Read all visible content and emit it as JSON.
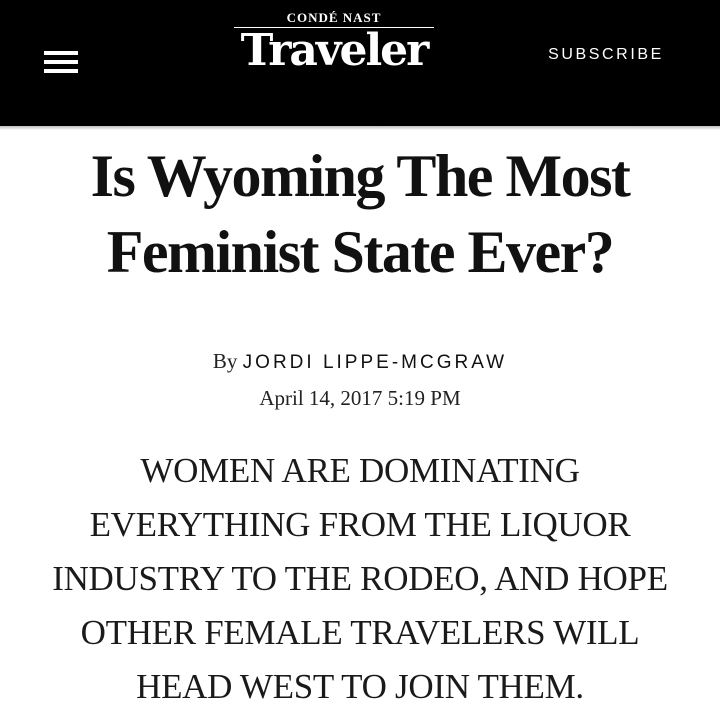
{
  "header": {
    "menu_icon": "hamburger-menu-icon",
    "publisher": "CONDÉ NAST",
    "wordmark": "Traveler",
    "subscribe_label": "SUBSCRIBE",
    "background_color": "#000000"
  },
  "article": {
    "headline": "Is Wyoming The Most Feminist State Ever?",
    "byline_prefix": "By",
    "author": "JORDI LIPPE-MCGRAW",
    "date": "April 14, 2017 5:19 PM",
    "dek": "WOMEN ARE DOMINATING EVERYTHING FROM THE LIQUOR INDUSTRY TO THE RODEO, AND HOPE OTHER FEMALE TRAVELERS WILL HEAD WEST TO JOIN THEM."
  }
}
